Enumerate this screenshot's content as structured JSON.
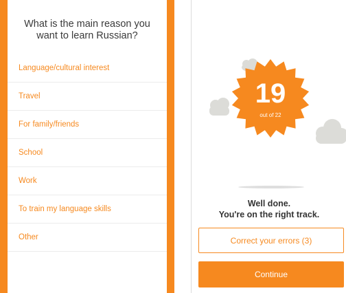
{
  "left": {
    "question": "What is the main reason you want to learn Russian?",
    "options": [
      "Language/cultural interest",
      "Travel",
      "For family/friends",
      "School",
      "Work",
      "To train my language skills",
      "Other"
    ]
  },
  "right": {
    "score": "19",
    "score_total": "out of 22",
    "message_line1": "Well done.",
    "message_line2": "You're on the right track.",
    "correct_button": "Correct your errors (3)",
    "continue_button": "Continue"
  },
  "colors": {
    "accent": "#f6891f",
    "cloud": "#dcdcd8",
    "text": "#333333"
  },
  "icons": [
    "cloud-icon",
    "starburst-badge-icon"
  ]
}
